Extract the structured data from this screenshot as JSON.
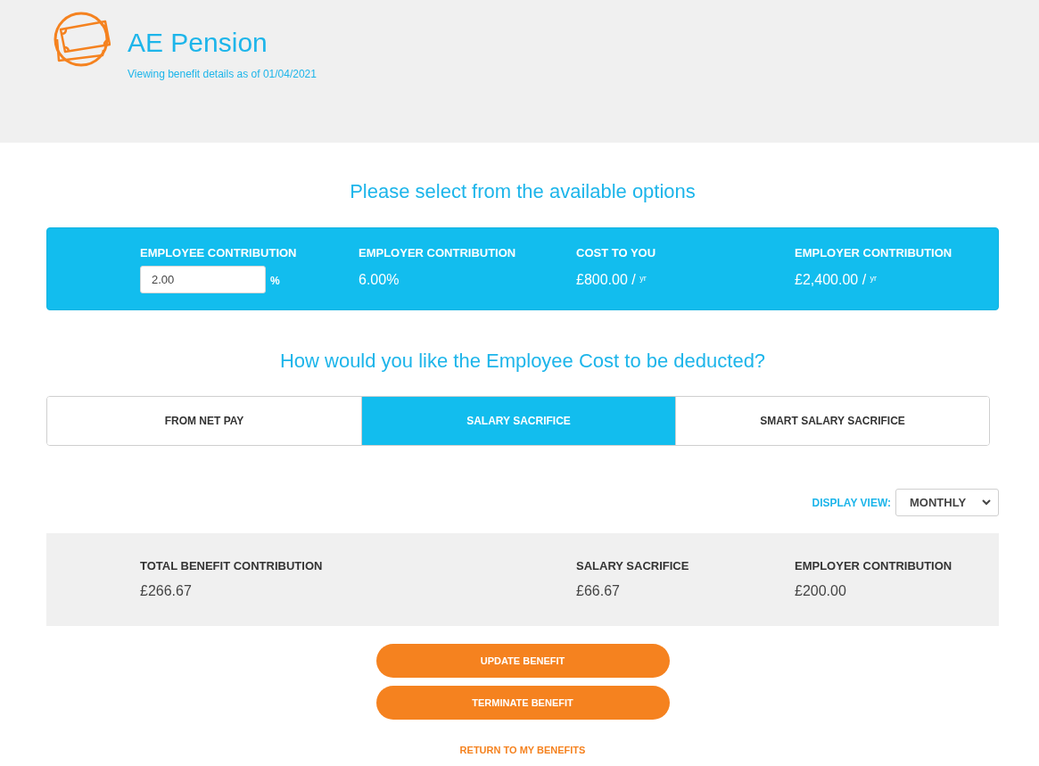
{
  "header": {
    "title": "AE Pension",
    "subtitle": "Viewing benefit details as of 01/04/2021"
  },
  "options": {
    "heading": "Please select from the available options",
    "fields": [
      {
        "kind": "input",
        "label": "EMPLOYEE CONTRIBUTION",
        "value": "2.00",
        "unit": "%"
      },
      {
        "kind": "text",
        "label": "EMPLOYER CONTRIBUTION",
        "value": "6.00%"
      },
      {
        "kind": "text",
        "label": "COST TO YOU",
        "value": "£800.00 / $^{yr}$"
      },
      {
        "kind": "text",
        "label": "EMPLOYER CONTRIBUTION",
        "value": "£2,400.00 / $^{yr}$"
      }
    ]
  },
  "deduction": {
    "heading": "How would you like the Employee Cost to be deducted?",
    "tabs": [
      {
        "label": "FROM NET PAY",
        "selected": false
      },
      {
        "label": "SALARY SACRIFICE",
        "selected": true
      },
      {
        "label": "SMART SALARY SACRIFICE",
        "selected": false
      }
    ]
  },
  "display_view": {
    "label": "DISPLAY VIEW:",
    "value": "MONTHLY"
  },
  "summary": [
    {
      "label": "TOTAL BENEFIT CONTRIBUTION",
      "value": "£266.67"
    },
    {
      "label": "SALARY SACRIFICE",
      "value": "£66.67"
    },
    {
      "label": "EMPLOYER CONTRIBUTION",
      "value": "£200.00"
    }
  ],
  "buttons": [
    "UPDATE BENEFIT",
    "TERMINATE BENEFIT"
  ],
  "return_link": "RETURN TO MY BENEFITS"
}
